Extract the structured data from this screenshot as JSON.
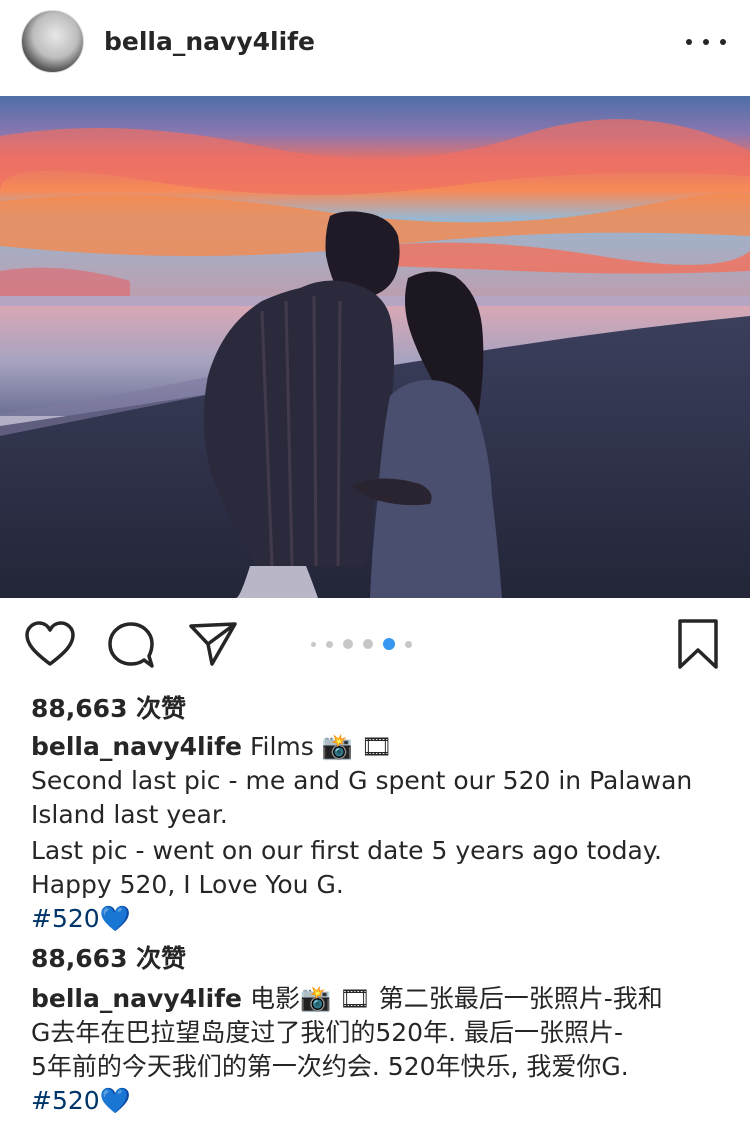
{
  "header": {
    "username": "bella_navy4life"
  },
  "actions": {
    "carousel_dots": 6,
    "active_dot": 4
  },
  "post": {
    "likes_en": "88,663 次赞",
    "caption_en": {
      "username": "bella_navy4life",
      "first": "Films",
      "emoji1": "📸",
      "emoji2": "🎞",
      "lines": [
        "Second last pic - me and G spent our 520 in Palawan",
        "Island last year.",
        "Last pic - went on our first date 5 years ago today.",
        "Happy 520, I Love You G."
      ],
      "hashtag": "#520",
      "heart": "💙"
    },
    "likes_cn": "88,663 次赞",
    "caption_cn": {
      "username": "bella_navy4life",
      "first": "电影",
      "emoji1": "📸",
      "emoji2": "🎞",
      "rest_first_line": "第二张最后一张照片-我和",
      "lines": [
        "G去年在巴拉望岛度过了我们的520年. 最后一张照片-",
        "5年前的今天我们的第一次约会. 520年快乐, 我爱你G."
      ],
      "hashtag": "#520",
      "heart": "💙"
    }
  },
  "colors": {
    "text": "#262626",
    "hashtag": "#003569",
    "active_dot": "#3897f0",
    "inactive_dot": "#c7c7c7"
  }
}
